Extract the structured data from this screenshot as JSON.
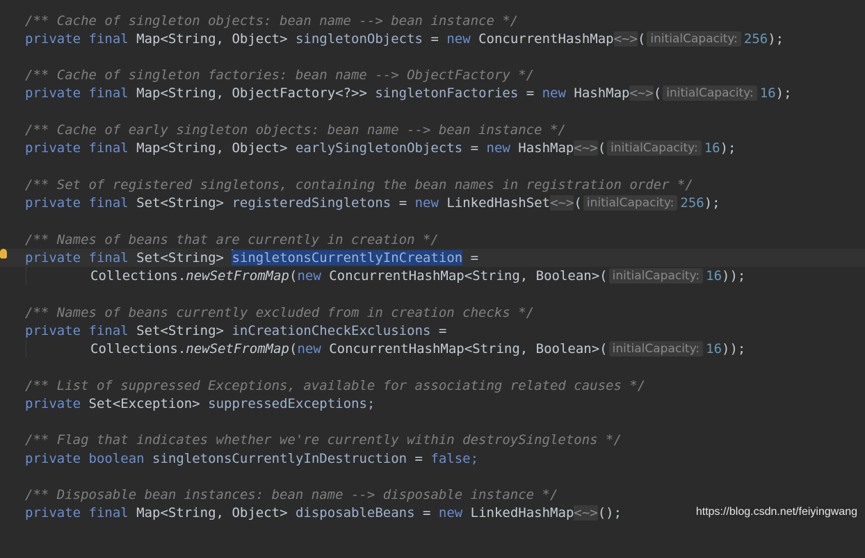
{
  "theme": {
    "background": "#2b2b2b",
    "keyword": "#6a8fd6",
    "comment": "#808080",
    "field": "#9fb3d1",
    "number": "#6897bb",
    "selection": "#214283"
  },
  "code": {
    "c1": "/** Cache of singleton objects: bean name --> bean instance */",
    "l2": {
      "mods": "private final",
      "type": "Map<String, Object>",
      "name": "singletonObjects",
      "eq": " = ",
      "newkw": "new",
      "ctor": "ConcurrentHashMap",
      "diamond": "<~>",
      "open": "(",
      "hint": "initialCapacity:",
      "arg": "256",
      "close": ");"
    },
    "c3": "/** Cache of singleton factories: bean name --> ObjectFactory */",
    "l4": {
      "mods": "private final",
      "type": "Map<String, ObjectFactory<?>>",
      "name": "singletonFactories",
      "eq": " = ",
      "newkw": "new",
      "ctor": "HashMap",
      "diamond": "<~>",
      "open": "(",
      "hint": "initialCapacity:",
      "arg": "16",
      "close": ");"
    },
    "c5": "/** Cache of early singleton objects: bean name --> bean instance */",
    "l6": {
      "mods": "private final",
      "type": "Map<String, Object>",
      "name": "earlySingletonObjects",
      "eq": " = ",
      "newkw": "new",
      "ctor": "HashMap",
      "diamond": "<~>",
      "open": "(",
      "hint": "initialCapacity:",
      "arg": "16",
      "close": ");"
    },
    "c7": "/** Set of registered singletons, containing the bean names in registration order */",
    "l8": {
      "mods": "private final",
      "type": "Set<String>",
      "name": "registeredSingletons",
      "eq": " = ",
      "newkw": "new",
      "ctor": "LinkedHashSet",
      "diamond": "<~>",
      "open": "(",
      "hint": "initialCapacity:",
      "arg": "256",
      "close": ");"
    },
    "c9": "/** Names of beans that are currently in creation */",
    "l10": {
      "mods": "private final",
      "type": "Set<String>",
      "name": "singletonsCurrentlyInCreation",
      "eq": " ="
    },
    "l11": {
      "prefix": "Collections.",
      "method": "newSetFromMap",
      "open": "(",
      "newkw": "new",
      "ctor": "ConcurrentHashMap<String, Boolean>(",
      "hint": "initialCapacity:",
      "arg": "16",
      "close": "));"
    },
    "c12": "/** Names of beans currently excluded from in creation checks */",
    "l13": {
      "mods": "private final",
      "type": "Set<String>",
      "name": "inCreationCheckExclusions",
      "eq": " ="
    },
    "l14": {
      "prefix": "Collections.",
      "method": "newSetFromMap",
      "open": "(",
      "newkw": "new",
      "ctor": "ConcurrentHashMap<String, Boolean>(",
      "hint": "initialCapacity:",
      "arg": "16",
      "close": "));"
    },
    "c15": "/** List of suppressed Exceptions, available for associating related causes */",
    "l16": {
      "mods": "private",
      "type": "Set<Exception>",
      "name": "suppressedExceptions;"
    },
    "c17": "/** Flag that indicates whether we're currently within destroySingletons */",
    "l18": {
      "mods": "private boolean",
      "name": "singletonsCurrentlyInDestruction",
      "eq": " = ",
      "value": "false;"
    },
    "c19": "/** Disposable bean instances: bean name --> disposable instance */",
    "l20": {
      "mods": "private final",
      "type": "Map<String, Object>",
      "name": "disposableBeans",
      "eq": " = ",
      "newkw": "new",
      "ctor": "LinkedHashMap",
      "diamond": "<~>",
      "close": "();"
    }
  },
  "watermark": "https://blog.csdn.net/feiyingwang"
}
